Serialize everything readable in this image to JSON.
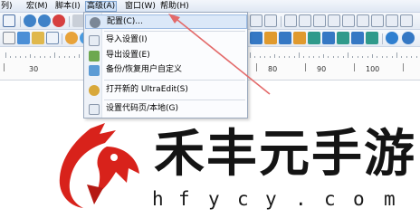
{
  "menubar": {
    "items": [
      "列)",
      "宏(M)",
      "脚本(I)",
      "高级(A)",
      "窗口(W)",
      "帮助(H)"
    ]
  },
  "dropdown": {
    "items": [
      {
        "label": "配置(C)...",
        "icon": "gear-icon",
        "highlighted": true
      },
      {
        "label": "导入设置(I)",
        "icon": "import-icon"
      },
      {
        "label": "导出设置(E)",
        "icon": "export-icon"
      },
      {
        "label": "备份/恢复用户自定义",
        "icon": "backup-icon"
      },
      {
        "label": "打开新的 UltraEdit(S)",
        "icon": "ultraedit-icon"
      },
      {
        "label": "设置代码页/本地(G)",
        "icon": "codepage-icon"
      }
    ]
  },
  "ruler": {
    "numbers": [
      "30",
      "80",
      "90",
      "100"
    ]
  },
  "watermark": {
    "chinese": [
      "禾",
      "丰",
      "元",
      "手",
      "游"
    ],
    "url": [
      "h",
      "f",
      "y",
      "c",
      "y",
      ".",
      "c",
      "o",
      "m"
    ]
  },
  "colors": {
    "arrow": "#e36a6a",
    "logo_red": "#d8221b",
    "menu_highlight": "#cde0f7"
  }
}
